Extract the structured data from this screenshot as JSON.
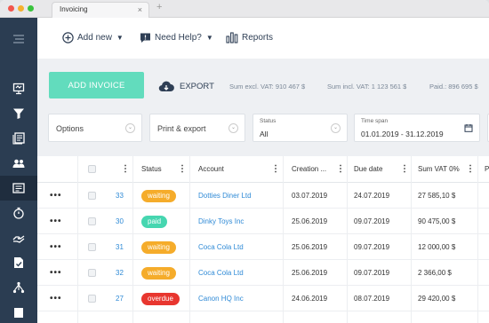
{
  "browser": {
    "tab_title": "Invoicing",
    "tab_close": "×",
    "new_tab": "+"
  },
  "topbar": {
    "add_new": "Add new",
    "need_help": "Need Help?",
    "reports": "Reports"
  },
  "actions": {
    "add_invoice": "ADD INVOICE",
    "export": "EXPORT"
  },
  "sums": {
    "excl": "Sum excl. VAT: 910 467 $",
    "incl": "Sum incl. VAT: 1 123 561 $",
    "paid": "Paid.: 896 695 $"
  },
  "filters": {
    "options": "Options",
    "print_export": "Print & export",
    "status_label": "Status",
    "status_value": "All",
    "timespan_label": "Time span",
    "timespan_value": "01.01.2019 - 31.12.2019"
  },
  "table": {
    "headers": {
      "status": "Status",
      "account": "Account",
      "creation": "Creation ...",
      "due": "Due date",
      "sum": "Sum VAT 0%",
      "extra": "P"
    },
    "rows": [
      {
        "number": "33",
        "status": "waiting",
        "account": "Dotties Diner Ltd",
        "creation": "03.07.2019",
        "due": "24.07.2019",
        "sum": "27 585,10 $"
      },
      {
        "number": "30",
        "status": "paid",
        "account": "Dinky Toys Inc",
        "creation": "25.06.2019",
        "due": "09.07.2019",
        "sum": "90 475,00 $"
      },
      {
        "number": "31",
        "status": "waiting",
        "account": "Coca Cola Ltd",
        "creation": "25.06.2019",
        "due": "09.07.2019",
        "sum": "12 000,00 $"
      },
      {
        "number": "32",
        "status": "waiting",
        "account": "Coca Cola Ltd",
        "creation": "25.06.2019",
        "due": "09.07.2019",
        "sum": "2 366,00 $"
      },
      {
        "number": "27",
        "status": "overdue",
        "account": "Canon HQ Inc",
        "creation": "24.06.2019",
        "due": "08.07.2019",
        "sum": "29 420,00 $"
      }
    ]
  },
  "colors": {
    "waiting": "#f5ac2b",
    "paid": "#46d6b0",
    "overdue": "#e8362f",
    "accent": "#62dcbd",
    "sidebar": "#2b3d52",
    "link": "#2f8ad6"
  }
}
